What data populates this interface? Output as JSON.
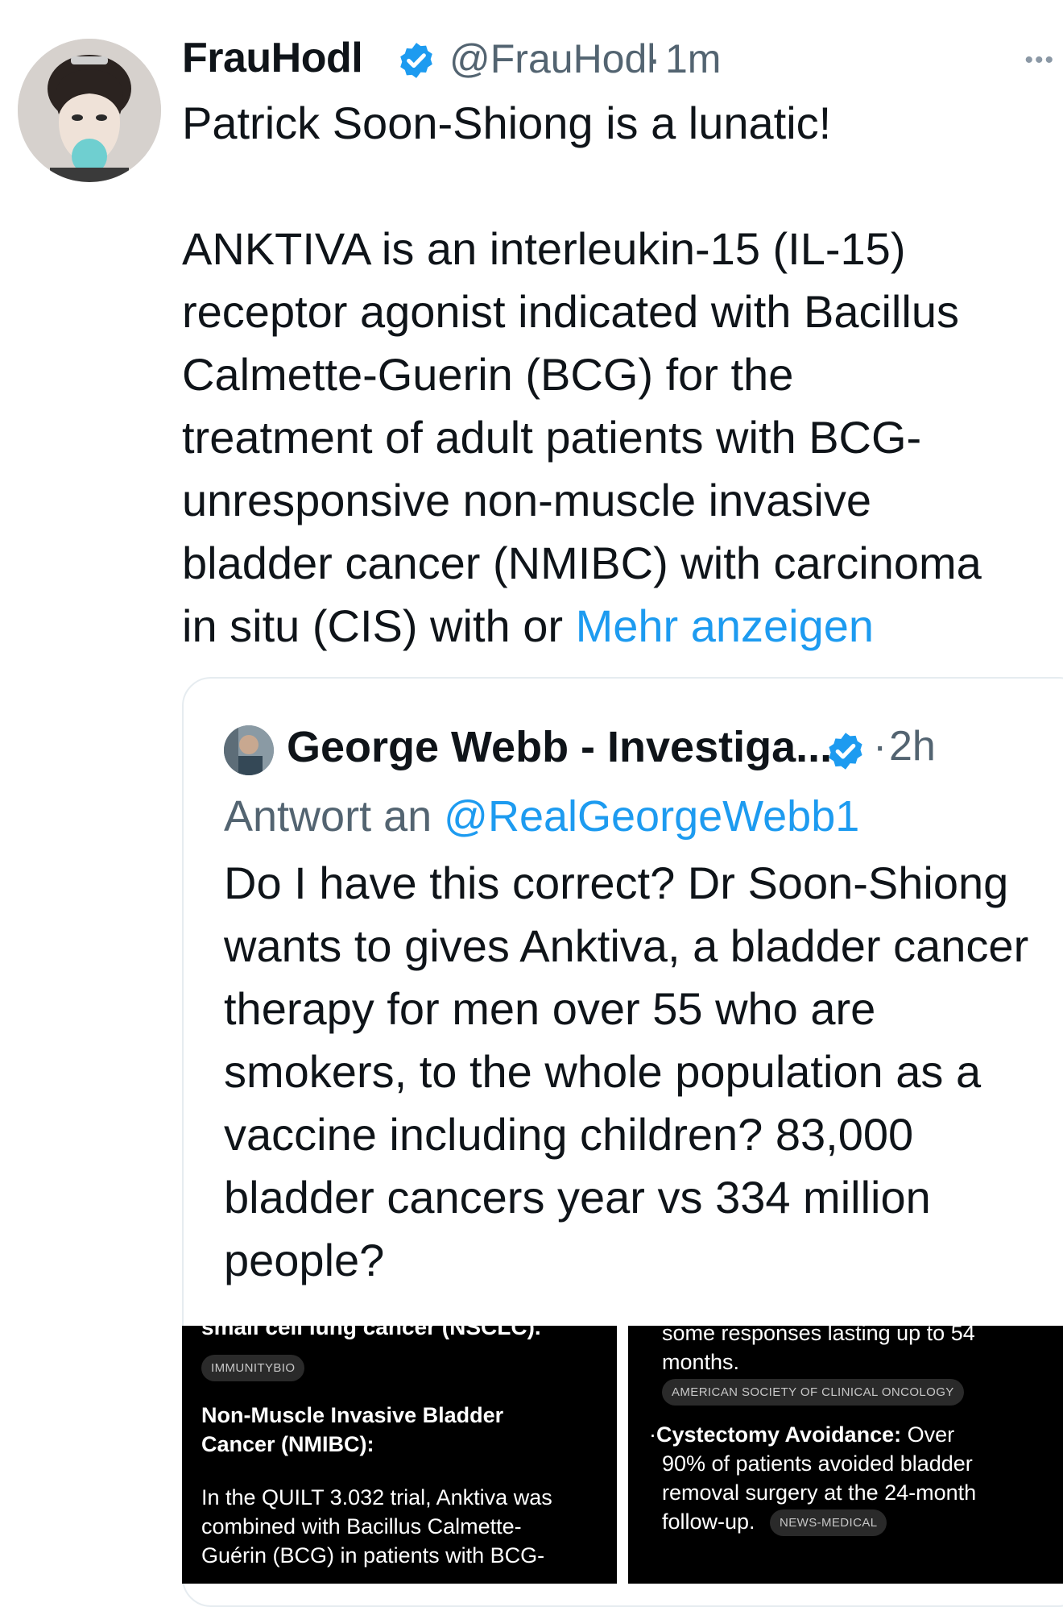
{
  "tweet": {
    "display_name": "FrauHodl",
    "handle": "@FrauHodl",
    "separator": "·",
    "time": "1m",
    "more_label": "•••",
    "text": "Patrick Soon-Shiong is a lunatic!\n\nANKTIVA is an interleukin-15 (IL-15)\nreceptor agonist indicated with Bacillus\nCalmette-Guerin (BCG) for the\ntreatment of adult patients with BCG-\nunresponsive non-muscle invasive\nbladder cancer (NMIBC) with carcinoma\nin situ (CIS) with or ",
    "show_more": "Mehr anzeigen"
  },
  "quote": {
    "display_name": "George Webb - Investiga...",
    "separator": "·",
    "time": "2h",
    "reply_prefix": "Antwort an ",
    "reply_to": "@RealGeorgeWebb1",
    "text": "Do I have this correct?  Dr Soon-Shiong wants to gives Anktiva, a bladder cancer therapy for men over 55 who are smokers, to the whole population as a vaccine including children?  83,000 bladder cancers year vs 334 million people?"
  },
  "screenshot_left": {
    "cut_line": "small cell lung cancer (NSCLC).",
    "tag1": "IMMUNITYBIO",
    "heading_line1": "Non-Muscle Invasive Bladder",
    "heading_line2": "Cancer (NMIBC):",
    "body_line1": "In the QUILT 3.032 trial, Anktiva was",
    "body_line2": "combined with Bacillus Calmette-",
    "body_line3": "Guérin (BCG) in patients with BCG-"
  },
  "screenshot_right": {
    "cut_line": "some responses lasting up to 54",
    "line2": "months.",
    "tag1": "AMERICAN SOCIETY OF CLINICAL ONCOLOGY",
    "bullet": "·",
    "bold_label": "Cystectomy Avoidance:",
    "line3_rest": " Over",
    "line4": "90% of patients avoided bladder",
    "line5": "removal surgery at the 24-month",
    "line6": "follow-up.",
    "tag2": "NEWS-MEDICAL"
  },
  "colors": {
    "link": "#1d9bf0",
    "verified": "#1d9bf0",
    "secondary_text": "#536471",
    "screenshot_bg": "#000000"
  }
}
